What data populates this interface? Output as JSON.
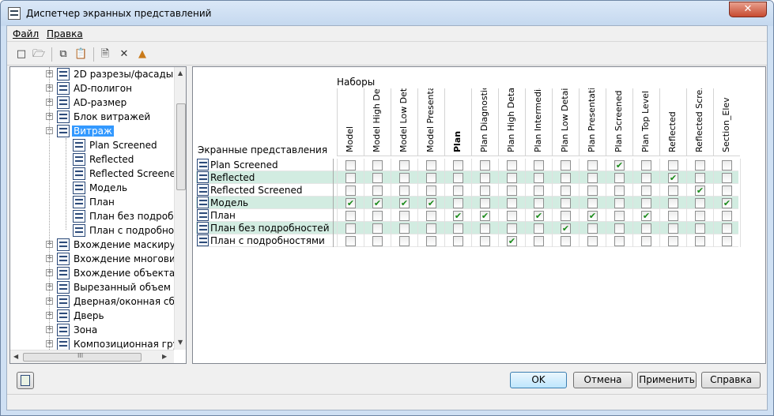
{
  "window": {
    "title": "Диспетчер экранных представлений",
    "close_glyph": "✕"
  },
  "menu": [
    "Файл",
    "Правка"
  ],
  "toolbar": [
    "new-icon",
    "open-icon",
    "copy-icon",
    "paste-icon",
    "new-set-icon",
    "delete-icon",
    "purge-icon"
  ],
  "tree": {
    "items": [
      {
        "label": "2D разрезы/фасады",
        "icon": "section-elevation-icon",
        "expand": "+",
        "indent": 0
      },
      {
        "label": "AD-полигон",
        "icon": "polygon-icon",
        "expand": "+",
        "indent": 0
      },
      {
        "label": "AD-размер",
        "icon": "dimension-icon",
        "expand": "+",
        "indent": 0
      },
      {
        "label": "Блок витражей",
        "icon": "curtain-wall-unit-icon",
        "expand": "+",
        "indent": 0
      },
      {
        "label": "Витраж",
        "icon": "curtain-wall-icon",
        "expand": "−",
        "indent": 0,
        "selected": true
      },
      {
        "label": "Plan Screened",
        "icon": "display-rep-icon",
        "expand": "",
        "indent": 1
      },
      {
        "label": "Reflected",
        "icon": "display-rep-icon",
        "expand": "",
        "indent": 1
      },
      {
        "label": "Reflected Screened",
        "icon": "display-rep-icon",
        "expand": "",
        "indent": 1
      },
      {
        "label": "Модель",
        "icon": "display-rep-icon",
        "expand": "",
        "indent": 1
      },
      {
        "label": "План",
        "icon": "display-rep-icon",
        "expand": "",
        "indent": 1
      },
      {
        "label": "План без подробностей",
        "icon": "display-rep-icon",
        "expand": "",
        "indent": 1
      },
      {
        "label": "План с подробностями",
        "icon": "display-rep-icon",
        "expand": "",
        "indent": 1
      },
      {
        "label": "Вхождение маскирующего блока",
        "icon": "mask-block-icon",
        "expand": "+",
        "indent": 0
      },
      {
        "label": "Вхождение многовидового блока",
        "icon": "mv-block-icon",
        "expand": "+",
        "indent": 0
      },
      {
        "label": "Вхождение объекта",
        "icon": "object-ref-icon",
        "expand": "+",
        "indent": 0
      },
      {
        "label": "Вырезанный объем",
        "icon": "cut-volume-icon",
        "expand": "+",
        "indent": 0
      },
      {
        "label": "Дверная/оконная сборка",
        "icon": "door-window-icon",
        "expand": "+",
        "indent": 0
      },
      {
        "label": "Дверь",
        "icon": "door-icon",
        "expand": "+",
        "indent": 0
      },
      {
        "label": "Зона",
        "icon": "zone-icon",
        "expand": "+",
        "indent": 0
      },
      {
        "label": "Композиционная группа",
        "icon": "group-icon",
        "expand": "+",
        "indent": 0
      }
    ],
    "scroll_up": "▲",
    "scroll_down": "▼",
    "scroll_left": "◀",
    "scroll_right": "▶",
    "hscroll_grip": "III"
  },
  "grid": {
    "sets_label": "Наборы",
    "rows_header": "Экранные представления",
    "columns": [
      {
        "label": "Model",
        "bold": false
      },
      {
        "label": "Model High Det...",
        "bold": false
      },
      {
        "label": "Model Low Detail",
        "bold": false
      },
      {
        "label": "Model Presenta...",
        "bold": false
      },
      {
        "label": "Plan",
        "bold": true
      },
      {
        "label": "Plan Diagnostic",
        "bold": false
      },
      {
        "label": "Plan High Detail",
        "bold": false
      },
      {
        "label": "Plan Intermedia...",
        "bold": false
      },
      {
        "label": "Plan Low Detail",
        "bold": false
      },
      {
        "label": "Plan Presentation",
        "bold": false
      },
      {
        "label": "Plan Screened",
        "bold": false
      },
      {
        "label": "Plan Top Level",
        "bold": false
      },
      {
        "label": "Reflected",
        "bold": false
      },
      {
        "label": "Reflected Scre...",
        "bold": false
      },
      {
        "label": "Section_Elev",
        "bold": false
      }
    ],
    "rows": [
      {
        "label": "Plan Screened",
        "checks": [
          0,
          0,
          0,
          0,
          0,
          0,
          0,
          0,
          0,
          0,
          1,
          0,
          0,
          0,
          0
        ]
      },
      {
        "label": "Reflected",
        "checks": [
          0,
          0,
          0,
          0,
          0,
          0,
          0,
          0,
          0,
          0,
          0,
          0,
          1,
          0,
          0
        ]
      },
      {
        "label": "Reflected Screened",
        "checks": [
          0,
          0,
          0,
          0,
          0,
          0,
          0,
          0,
          0,
          0,
          0,
          0,
          0,
          1,
          0
        ]
      },
      {
        "label": "Модель",
        "checks": [
          1,
          1,
          1,
          1,
          0,
          0,
          0,
          0,
          0,
          0,
          0,
          0,
          0,
          0,
          1
        ]
      },
      {
        "label": "План",
        "checks": [
          0,
          0,
          0,
          0,
          1,
          1,
          0,
          1,
          0,
          1,
          0,
          1,
          0,
          0,
          0
        ]
      },
      {
        "label": "План без подробностей",
        "checks": [
          0,
          0,
          0,
          0,
          0,
          0,
          0,
          0,
          1,
          0,
          0,
          0,
          0,
          0,
          0
        ]
      },
      {
        "label": "План с подробностями",
        "checks": [
          0,
          0,
          0,
          0,
          0,
          0,
          1,
          0,
          0,
          0,
          0,
          0,
          0,
          0,
          0
        ]
      }
    ],
    "check_glyph": "✔"
  },
  "buttons": {
    "ok": "OK",
    "cancel": "Отмена",
    "apply": "Применить",
    "help": "Справка"
  }
}
